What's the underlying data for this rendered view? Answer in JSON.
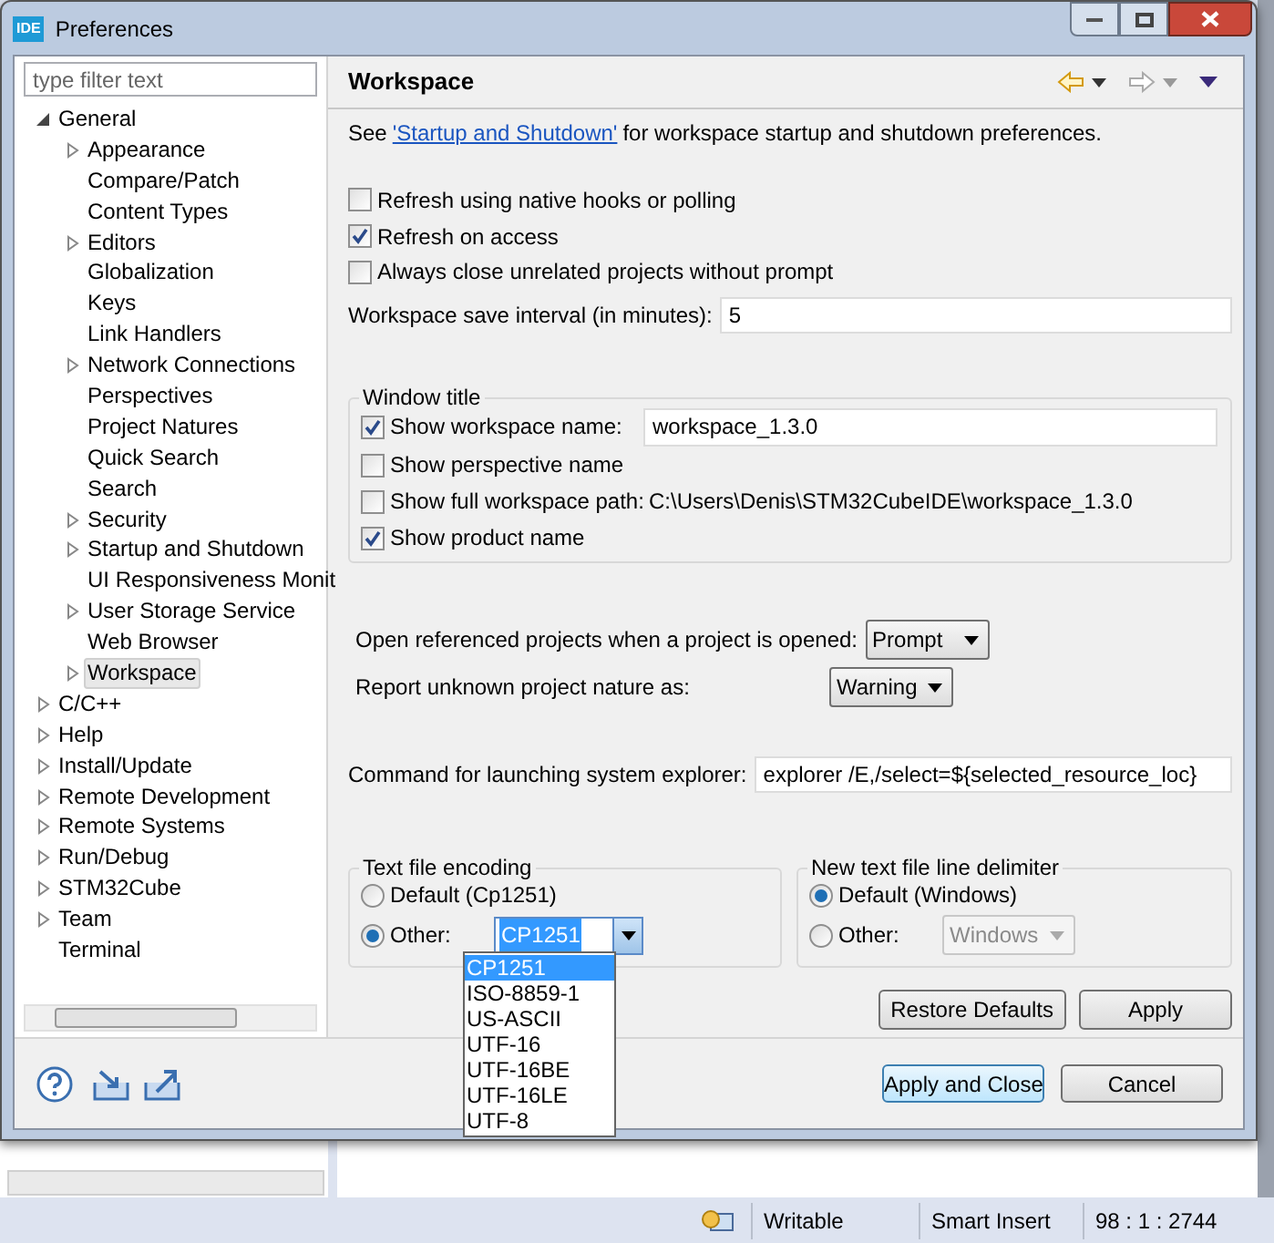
{
  "window": {
    "icon_text": "IDE",
    "title": "Preferences"
  },
  "filter": {
    "placeholder": "type filter text"
  },
  "tree": [
    {
      "label": "General",
      "kind": "folder",
      "expanded": true,
      "selected": false,
      "children": [
        {
          "label": "Appearance",
          "kind": "folder",
          "expanded": false,
          "selected": false
        },
        {
          "label": "Compare/Patch",
          "kind": "leaf",
          "selected": false
        },
        {
          "label": "Content Types",
          "kind": "leaf",
          "selected": false
        },
        {
          "label": "Editors",
          "kind": "folder",
          "expanded": false,
          "selected": false
        },
        {
          "label": "Globalization",
          "kind": "leaf",
          "selected": false
        },
        {
          "label": "Keys",
          "kind": "leaf",
          "selected": false
        },
        {
          "label": "Link Handlers",
          "kind": "leaf",
          "selected": false
        },
        {
          "label": "Network Connections",
          "kind": "folder",
          "expanded": false,
          "selected": false
        },
        {
          "label": "Perspectives",
          "kind": "leaf",
          "selected": false
        },
        {
          "label": "Project Natures",
          "kind": "leaf",
          "selected": false
        },
        {
          "label": "Quick Search",
          "kind": "leaf",
          "selected": false
        },
        {
          "label": "Search",
          "kind": "leaf",
          "selected": false
        },
        {
          "label": "Security",
          "kind": "folder",
          "expanded": false,
          "selected": false
        },
        {
          "label": "Startup and Shutdown",
          "kind": "folder",
          "expanded": false,
          "selected": false
        },
        {
          "label": "UI Responsiveness Monit",
          "kind": "leaf",
          "selected": false
        },
        {
          "label": "User Storage Service",
          "kind": "folder",
          "expanded": false,
          "selected": false
        },
        {
          "label": "Web Browser",
          "kind": "leaf",
          "selected": false
        },
        {
          "label": "Workspace",
          "kind": "folder",
          "expanded": false,
          "selected": true
        }
      ]
    },
    {
      "label": "C/C++",
      "kind": "folder",
      "expanded": false,
      "selected": false
    },
    {
      "label": "Help",
      "kind": "folder",
      "expanded": false,
      "selected": false
    },
    {
      "label": "Install/Update",
      "kind": "folder",
      "expanded": false,
      "selected": false
    },
    {
      "label": "Remote Development",
      "kind": "folder",
      "expanded": false,
      "selected": false
    },
    {
      "label": "Remote Systems",
      "kind": "folder",
      "expanded": false,
      "selected": false
    },
    {
      "label": "Run/Debug",
      "kind": "folder",
      "expanded": false,
      "selected": false
    },
    {
      "label": "STM32Cube",
      "kind": "folder",
      "expanded": false,
      "selected": false
    },
    {
      "label": "Team",
      "kind": "folder",
      "expanded": false,
      "selected": false
    },
    {
      "label": "Terminal",
      "kind": "leaf",
      "selected": false
    }
  ],
  "page": {
    "title": "Workspace",
    "intro": {
      "before": "See",
      "link": "'Startup and Shutdown'",
      "after": "for workspace startup and shutdown preferences."
    },
    "checkboxes": [
      {
        "label": "Refresh using native hooks or polling",
        "checked": false
      },
      {
        "label": "Refresh on access",
        "checked": true
      },
      {
        "label": "Always close unrelated projects without prompt",
        "checked": false
      }
    ],
    "save_interval": {
      "label": "Workspace save interval (in minutes):",
      "value": "5"
    },
    "window_title": {
      "title": "Window title",
      "options": [
        {
          "kind": "field",
          "label": "Show workspace name:",
          "checked": true,
          "value": "workspace_1.3.0"
        },
        {
          "kind": "plain",
          "label": "Show perspective name",
          "checked": false
        },
        {
          "kind": "path",
          "label": "Show full workspace path:",
          "checked": false,
          "path": "C:\\Users\\Denis\\STM32CubeIDE\\workspace_1.3.0"
        },
        {
          "kind": "plain",
          "label": "Show product name",
          "checked": true
        }
      ]
    },
    "dropdowns": [
      {
        "label": "Open referenced projects when a project is opened:",
        "value": "Prompt"
      },
      {
        "label": "Report unknown project nature as:",
        "value": "Warning"
      }
    ],
    "explorer_command": {
      "label": "Command for launching system explorer:",
      "value": "explorer /E,/select=${selected_resource_loc}"
    },
    "encoding": {
      "title": "Text file encoding",
      "options": [
        {
          "label": "Default (Cp1251)",
          "selected": false
        },
        {
          "label": "Other:",
          "selected": true,
          "value": "CP1251",
          "disabled": false
        }
      ],
      "list": [
        {
          "label": "CP1251",
          "selected": true
        },
        {
          "label": "ISO-8859-1",
          "selected": false
        },
        {
          "label": "US-ASCII",
          "selected": false
        },
        {
          "label": "UTF-16",
          "selected": false
        },
        {
          "label": "UTF-16BE",
          "selected": false
        },
        {
          "label": "UTF-16LE",
          "selected": false
        },
        {
          "label": "UTF-8",
          "selected": false
        }
      ]
    },
    "line_delimiter": {
      "title": "New text file line delimiter",
      "options": [
        {
          "label": "Default (Windows)",
          "selected": true
        },
        {
          "label": "Other:",
          "selected": false,
          "value": "Windows",
          "disabled": true
        }
      ]
    },
    "buttons": [
      "Restore Defaults",
      "Apply"
    ]
  },
  "footer_buttons": [
    {
      "label": "Apply and Close",
      "default": true
    },
    {
      "label": "Cancel",
      "default": false
    }
  ],
  "status_bar": [
    "Writable",
    "Smart Insert",
    "98 : 1 : 2744"
  ]
}
